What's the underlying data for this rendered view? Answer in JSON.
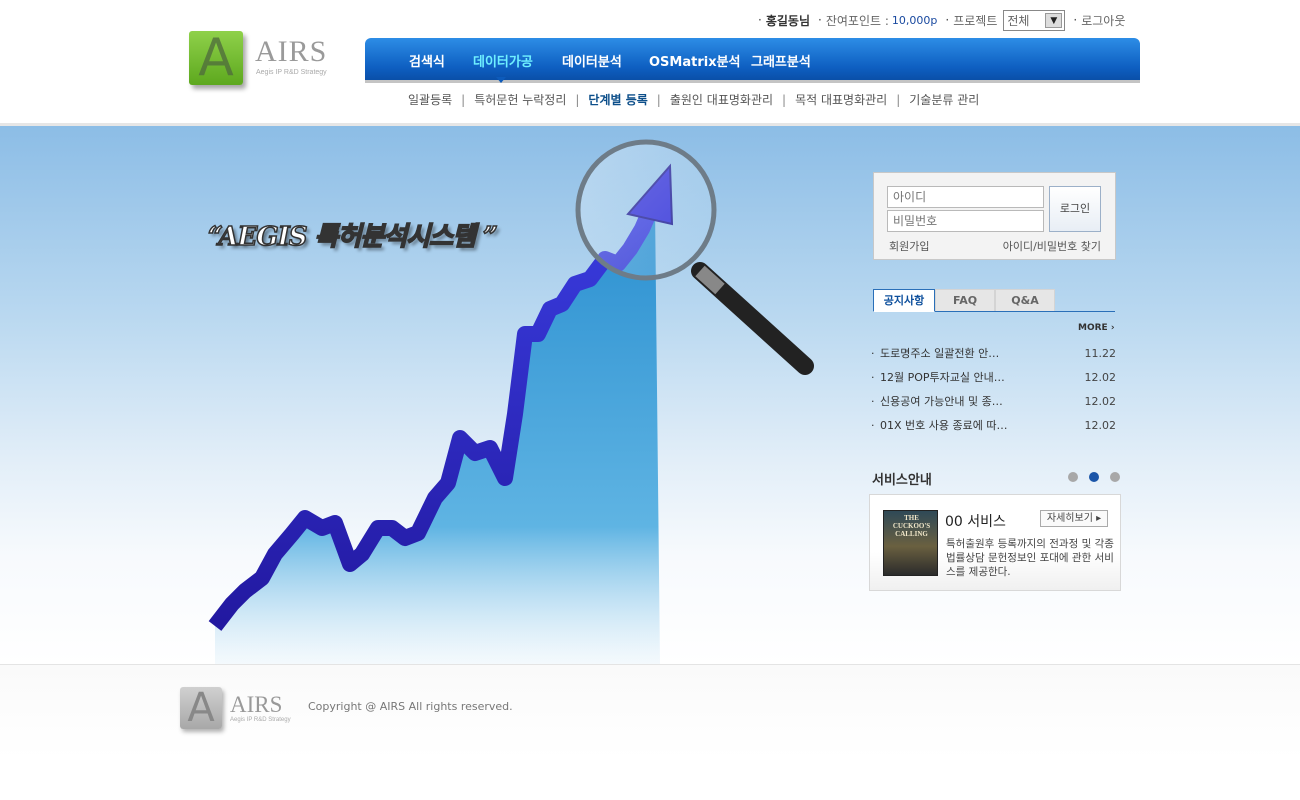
{
  "brand": {
    "logo_letter": "A",
    "name": "AIRS",
    "tagline": "Aegis IP R&D Strategy"
  },
  "util": {
    "user": "홍길동님",
    "points_label": "잔여포인트 :",
    "points_value": "10,000p",
    "project_label": "프로젝트",
    "project_selected": "전체",
    "logout": "로그아웃"
  },
  "gnb": {
    "items": [
      "검색식",
      "데이터가공",
      "데이터분석",
      "OSMatrix분석",
      "그래프분석"
    ],
    "active": "데이터가공"
  },
  "lnb": {
    "items": [
      "일괄등록",
      "특허문헌 누락정리",
      "단계별 등록",
      "출원인 대표명화관리",
      "목적 대표명화관리",
      "기술분류 관리"
    ],
    "current": "단계별 등록"
  },
  "visual": {
    "slogan": "“AEGIS 특허분석시스템 ”"
  },
  "login": {
    "id_placeholder": "아이디",
    "pw_placeholder": "비밀번호",
    "button": "로그인",
    "join": "회원가입",
    "find": "아이디/비밀번호 찾기"
  },
  "board": {
    "tabs": [
      "공지사항",
      "FAQ",
      "Q&A"
    ],
    "active_tab": "공지사항",
    "more": "MORE",
    "notices": [
      {
        "title": "도로명주소 일괄전환 안…",
        "date": "11.22"
      },
      {
        "title": "12월 POP투자교실 안내…",
        "date": "12.02"
      },
      {
        "title": "신용공여 가능안내 및 종…",
        "date": "12.02"
      },
      {
        "title": "01X 번호 사용 종료에 따…",
        "date": "12.02"
      }
    ]
  },
  "service": {
    "title": "서비스안내",
    "pages": 3,
    "active_page": 2,
    "name": "00 서비스",
    "detail_button": "자세히보기",
    "book_cover_text": "THE CUCKOO'S CALLING",
    "description": "특허출원후 등록까지의 전과정 및 각종 법률상담 문헌정보인 포대에 관한 서비스를 제공한다."
  },
  "footer": {
    "copyright": "Copyright @ AIRS All rights reserved."
  },
  "colors": {
    "gnb_blue": "#0e5fc1",
    "active_menu": "#6ff0ff",
    "logo_green": "#7cc238",
    "tab_blue": "#2a6fb8"
  }
}
